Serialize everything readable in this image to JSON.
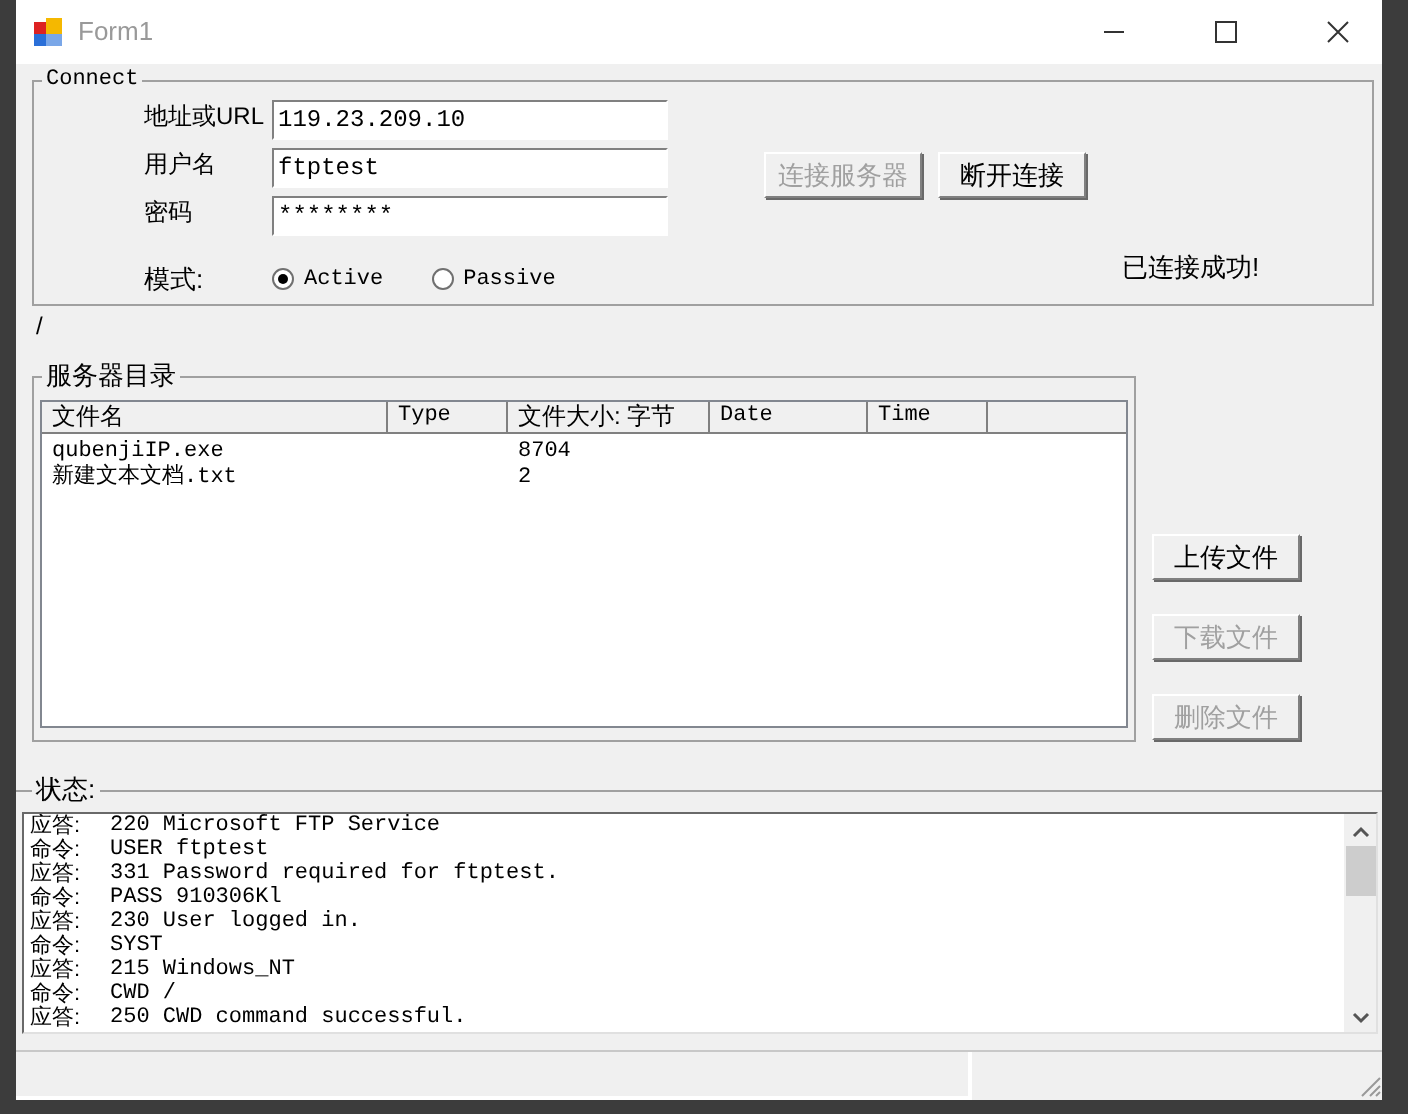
{
  "window": {
    "title": "Form1"
  },
  "connect": {
    "title": "Connect",
    "fields": [
      {
        "label": "地址或URL",
        "value": "119.23.209.10"
      },
      {
        "label": "用户名",
        "value": "ftptest"
      },
      {
        "label": "密码",
        "value": "********"
      }
    ],
    "mode_label": "模式:",
    "modes": [
      {
        "label": "Active",
        "selected": true
      },
      {
        "label": "Passive",
        "selected": false
      }
    ],
    "buttons": [
      {
        "label": "连接服务器",
        "disabled": true
      },
      {
        "label": "断开连接",
        "disabled": false
      }
    ],
    "status": "已连接成功!"
  },
  "path": "/",
  "server": {
    "title": "服务器目录",
    "columns": [
      "文件名",
      "Type",
      "文件大小: 字节",
      "Date",
      "Time"
    ],
    "rows": [
      [
        "qubenjiIP.exe",
        "",
        "8704",
        "",
        ""
      ],
      [
        "新建文本文档.txt",
        "",
        "2",
        "",
        ""
      ]
    ]
  },
  "file_buttons": [
    {
      "label": "上传文件",
      "disabled": false
    },
    {
      "label": "下载文件",
      "disabled": true
    },
    {
      "label": "删除文件",
      "disabled": true
    }
  ],
  "log": {
    "title": "状态:",
    "lines": [
      {
        "label": "应答:",
        "text": "220 Microsoft FTP Service"
      },
      {
        "label": "命令:",
        "text": "USER ftptest"
      },
      {
        "label": "应答:",
        "text": "331 Password required for ftptest."
      },
      {
        "label": "命令:",
        "text": "PASS 910306Kl"
      },
      {
        "label": "应答:",
        "text": "230 User logged in."
      },
      {
        "label": "命令:",
        "text": "SYST"
      },
      {
        "label": "应答:",
        "text": "215 Windows_NT"
      },
      {
        "label": "命令:",
        "text": "CWD /"
      },
      {
        "label": "应答:",
        "text": "250 CWD command successful."
      }
    ]
  }
}
